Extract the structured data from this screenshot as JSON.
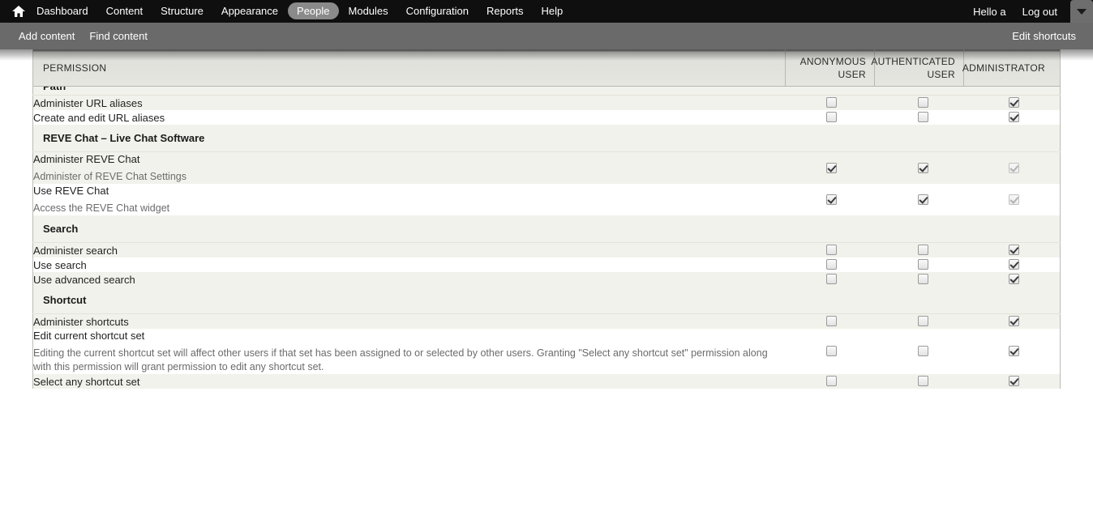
{
  "toolbar": {
    "home_icon": "home-icon",
    "items": [
      {
        "label": "Dashboard",
        "active": false
      },
      {
        "label": "Content",
        "active": false
      },
      {
        "label": "Structure",
        "active": false
      },
      {
        "label": "Appearance",
        "active": false
      },
      {
        "label": "People",
        "active": true
      },
      {
        "label": "Modules",
        "active": false
      },
      {
        "label": "Configuration",
        "active": false
      },
      {
        "label": "Reports",
        "active": false
      },
      {
        "label": "Help",
        "active": false
      }
    ],
    "greeting": "Hello a",
    "logout": "Log out",
    "drawer_toggle_icon": "chevron-down-icon"
  },
  "shortcut_bar": {
    "items": [
      {
        "label": "Add content"
      },
      {
        "label": "Find content"
      }
    ],
    "edit_shortcuts": "Edit shortcuts"
  },
  "table": {
    "headers": {
      "permission": "PERMISSION",
      "roles": [
        {
          "line1": "ANONYMOUS",
          "line2": "USER"
        },
        {
          "line1": "AUTHENTICATED",
          "line2": "USER"
        },
        {
          "line1": "ADMINISTRATOR",
          "line2": ""
        }
      ]
    },
    "rows": [
      {
        "type": "group",
        "label": "Path",
        "clipped": true
      },
      {
        "type": "perm",
        "title": "Administer URL aliases",
        "desc": "",
        "checks": [
          {
            "checked": false,
            "disabled": false
          },
          {
            "checked": false,
            "disabled": false
          },
          {
            "checked": true,
            "disabled": false
          }
        ]
      },
      {
        "type": "perm",
        "title": "Create and edit URL aliases",
        "desc": "",
        "checks": [
          {
            "checked": false,
            "disabled": false
          },
          {
            "checked": false,
            "disabled": false
          },
          {
            "checked": true,
            "disabled": false
          }
        ]
      },
      {
        "type": "group",
        "label": "REVE Chat – Live Chat Software"
      },
      {
        "type": "perm",
        "title": "Administer REVE Chat",
        "desc": "Administer of REVE Chat Settings",
        "checks": [
          {
            "checked": true,
            "disabled": false
          },
          {
            "checked": true,
            "disabled": false
          },
          {
            "checked": true,
            "disabled": true
          }
        ]
      },
      {
        "type": "perm",
        "title": "Use REVE Chat",
        "desc": "Access the REVE Chat widget",
        "checks": [
          {
            "checked": true,
            "disabled": false
          },
          {
            "checked": true,
            "disabled": false
          },
          {
            "checked": true,
            "disabled": true
          }
        ]
      },
      {
        "type": "group",
        "label": "Search"
      },
      {
        "type": "perm",
        "title": "Administer search",
        "desc": "",
        "checks": [
          {
            "checked": false,
            "disabled": false
          },
          {
            "checked": false,
            "disabled": false
          },
          {
            "checked": true,
            "disabled": false
          }
        ]
      },
      {
        "type": "perm",
        "title": "Use search",
        "desc": "",
        "checks": [
          {
            "checked": false,
            "disabled": false
          },
          {
            "checked": false,
            "disabled": false
          },
          {
            "checked": true,
            "disabled": false
          }
        ]
      },
      {
        "type": "perm",
        "title": "Use advanced search",
        "desc": "",
        "checks": [
          {
            "checked": false,
            "disabled": false
          },
          {
            "checked": false,
            "disabled": false
          },
          {
            "checked": true,
            "disabled": false
          }
        ]
      },
      {
        "type": "group",
        "label": "Shortcut"
      },
      {
        "type": "perm",
        "title": "Administer shortcuts",
        "desc": "",
        "checks": [
          {
            "checked": false,
            "disabled": false
          },
          {
            "checked": false,
            "disabled": false
          },
          {
            "checked": true,
            "disabled": false
          }
        ]
      },
      {
        "type": "perm",
        "title": "Edit current shortcut set",
        "desc": "Editing the current shortcut set will affect other users if that set has been assigned to or selected by other users. Granting \"Select any shortcut set\" permission along with this permission will grant permission to edit any shortcut set.",
        "checks": [
          {
            "checked": false,
            "disabled": false
          },
          {
            "checked": false,
            "disabled": false
          },
          {
            "checked": true,
            "disabled": false
          }
        ]
      },
      {
        "type": "perm",
        "title": "Select any shortcut set",
        "desc": "",
        "checks": [
          {
            "checked": false,
            "disabled": false
          },
          {
            "checked": false,
            "disabled": false
          },
          {
            "checked": true,
            "disabled": false
          }
        ]
      }
    ]
  },
  "colors": {
    "toolbar_bg": "#0f0f0f",
    "shortcutbar_bg": "#6a6a6a",
    "active_tab_bg": "#8a8a8a",
    "row_odd_bg": "#f2f2ec",
    "row_even_bg": "#ffffff",
    "header_bg": "#e6e6e0",
    "text": "#222222",
    "muted_text": "#6b6b6b"
  }
}
